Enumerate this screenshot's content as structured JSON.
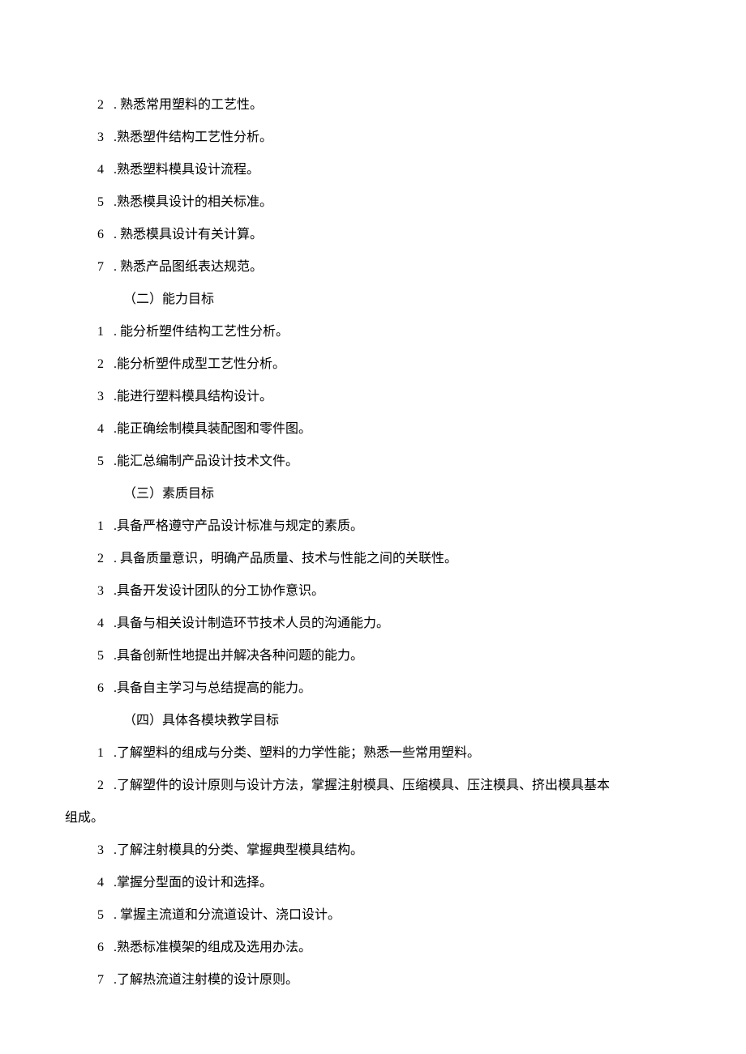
{
  "section1_items_a": [
    {
      "num": "2",
      "sep": " . ",
      "text": "熟悉常用塑料的工艺性。"
    },
    {
      "num": "3",
      "sep": " .",
      "text": "熟悉塑件结构工艺性分析。"
    },
    {
      "num": "4",
      "sep": " .",
      "text": "熟悉塑料模具设计流程。"
    },
    {
      "num": "5",
      "sep": " .",
      "text": "熟悉模具设计的相关标准。"
    },
    {
      "num": "6",
      "sep": " . ",
      "text": "熟悉模具设计有关计算。"
    },
    {
      "num": "7",
      "sep": " . ",
      "text": "熟悉产品图纸表达规范。"
    }
  ],
  "section2_title": "（二）能力目标",
  "section2_items": [
    {
      "num": "1",
      "sep": " . ",
      "text": "能分析塑件结构工艺性分析。"
    },
    {
      "num": "2",
      "sep": " .",
      "text": "能分析塑件成型工艺性分析。"
    },
    {
      "num": "3",
      "sep": " .",
      "text": "能进行塑料模具结构设计。"
    },
    {
      "num": "4",
      "sep": " .",
      "text": "能正确绘制模具装配图和零件图。"
    },
    {
      "num": "5",
      "sep": " .",
      "text": "能汇总编制产品设计技术文件。"
    }
  ],
  "section3_title": "（三）素质目标",
  "section3_items": [
    {
      "num": "1",
      "sep": " .",
      "text": "具备严格遵守产品设计标准与规定的素质。"
    },
    {
      "num": "2",
      "sep": " . ",
      "text": "具备质量意识，明确产品质量、技术与性能之间的关联性。"
    },
    {
      "num": "3",
      "sep": " .",
      "text": "具备开发设计团队的分工协作意识。"
    },
    {
      "num": "4",
      "sep": " .",
      "text": "具备与相关设计制造环节技术人员的沟通能力。"
    },
    {
      "num": "5",
      "sep": " .",
      "text": "具备创新性地提出并解决各种问题的能力。"
    },
    {
      "num": "6",
      "sep": " .",
      "text": "具备自主学习与总结提高的能力。"
    }
  ],
  "section4_title": "（四）具体各模块教学目标",
  "section4_items": [
    {
      "num": "1",
      "sep": " .",
      "text": "了解塑料的组成与分类、塑料的力学性能；熟悉一些常用塑料。"
    },
    {
      "num": "2",
      "sep": " .",
      "text": "了解塑件的设计原则与设计方法，掌握注射模具、压缩模具、压注模具、挤出模具基本"
    }
  ],
  "section4_wrap": "组成。",
  "section4_items_b": [
    {
      "num": "3",
      "sep": " .",
      "text": "了解注射模具的分类、掌握典型模具结构。"
    },
    {
      "num": "4",
      "sep": " .",
      "text": "掌握分型面的设计和选择。"
    },
    {
      "num": "5",
      "sep": " . ",
      "text": "掌握主流道和分流道设计、浇口设计。"
    },
    {
      "num": "6",
      "sep": " .",
      "text": "熟悉标准模架的组成及选用办法。"
    },
    {
      "num": "7",
      "sep": " .",
      "text": "了解热流道注射模的设计原则。"
    }
  ]
}
